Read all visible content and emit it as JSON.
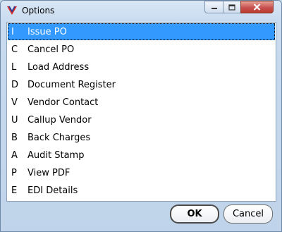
{
  "window": {
    "title": "Options",
    "controls": {
      "minimize_icon": "minimize-icon",
      "maximize_icon": "maximize-icon",
      "close_icon": "close-icon"
    }
  },
  "list": {
    "selected_index": 0,
    "selection_color": "#3399ff",
    "items": [
      {
        "key": "I",
        "label": "Issue PO"
      },
      {
        "key": "C",
        "label": "Cancel PO"
      },
      {
        "key": "L",
        "label": "Load Address"
      },
      {
        "key": "D",
        "label": "Document Register"
      },
      {
        "key": "V",
        "label": "Vendor Contact"
      },
      {
        "key": "U",
        "label": "Callup Vendor"
      },
      {
        "key": "B",
        "label": "Back Charges"
      },
      {
        "key": "A",
        "label": "Audit Stamp"
      },
      {
        "key": "P",
        "label": "View PDF"
      },
      {
        "key": "E",
        "label": "EDI Details"
      }
    ]
  },
  "buttons": {
    "ok_label": "OK",
    "cancel_label": "Cancel"
  }
}
